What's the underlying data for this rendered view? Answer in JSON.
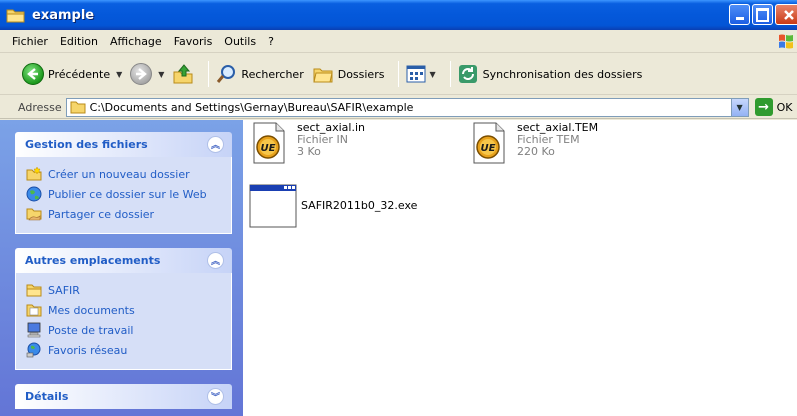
{
  "window": {
    "title": "example"
  },
  "menu": {
    "items": [
      "Fichier",
      "Edition",
      "Affichage",
      "Favoris",
      "Outils",
      "?"
    ]
  },
  "toolbar": {
    "back_label": "Précédente",
    "search_label": "Rechercher",
    "folders_label": "Dossiers",
    "sync_label": "Synchronisation des dossiers"
  },
  "address": {
    "label": "Adresse",
    "value": "C:\\Documents and Settings\\Gernay\\Bureau\\SAFIR\\example",
    "go_label": "OK"
  },
  "tasks": {
    "file_tasks": {
      "title": "Gestion des fichiers",
      "items": [
        {
          "label": "Créer un nouveau dossier",
          "icon": "new-folder-icon"
        },
        {
          "label": "Publier ce dossier sur le Web",
          "icon": "globe-icon"
        },
        {
          "label": "Partager ce dossier",
          "icon": "share-folder-icon"
        }
      ]
    },
    "other_places": {
      "title": "Autres emplacements",
      "items": [
        {
          "label": "SAFIR",
          "icon": "folder-icon"
        },
        {
          "label": "Mes documents",
          "icon": "my-documents-icon"
        },
        {
          "label": "Poste de travail",
          "icon": "computer-icon"
        },
        {
          "label": "Favoris réseau",
          "icon": "network-icon"
        }
      ]
    },
    "details": {
      "title": "Détails"
    }
  },
  "files": [
    {
      "name": "sect_axial.in",
      "type": "Fichier IN",
      "size": "3 Ko",
      "icon": "ultraedit-icon"
    },
    {
      "name": "sect_axial.TEM",
      "type": "Fichier TEM",
      "size": "220 Ko",
      "icon": "ultraedit-icon"
    },
    {
      "name": "SAFIR2011b0_32.exe",
      "icon": "application-window-icon"
    }
  ],
  "colors": {
    "titlebar": "#0458da",
    "link": "#215dc6",
    "sidebar": "#6f8de0"
  }
}
